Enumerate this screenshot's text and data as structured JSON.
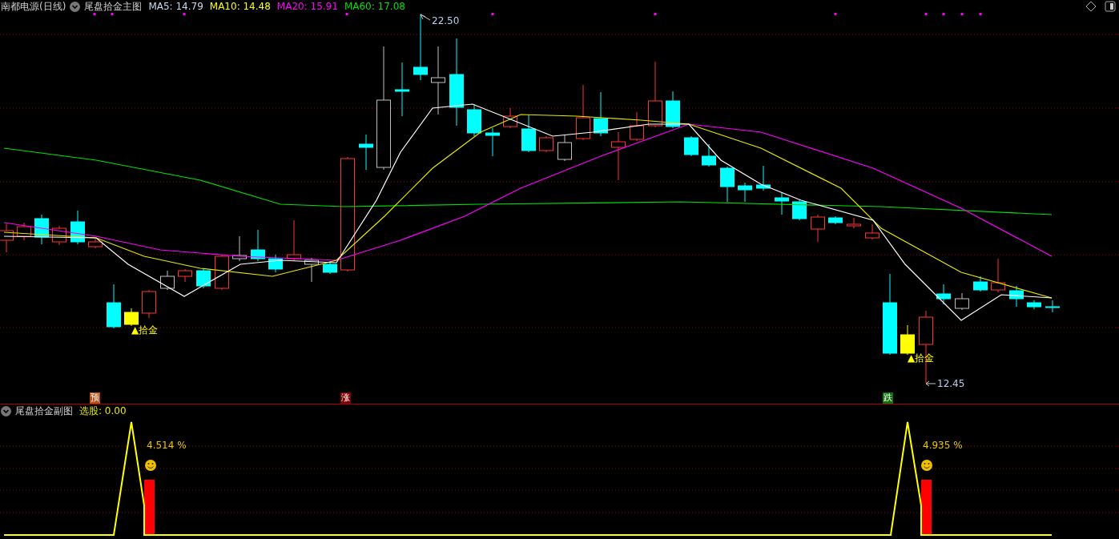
{
  "header": {
    "stock": "南都电源(日线)",
    "indicator": "尾盘拾金主图",
    "legend": [
      {
        "label": "MA5: 14.79",
        "color": "#c8dcf0"
      },
      {
        "label": "MA10: 14.48",
        "color": "#ffff00"
      },
      {
        "label": "MA20: 15.91",
        "color": "#ff00ff"
      },
      {
        "label": "MA60: 17.08",
        "color": "#00e000"
      }
    ]
  },
  "annotations": {
    "high": "22.50",
    "low": "12.45"
  },
  "signals": [
    {
      "label": "▲拾金"
    },
    {
      "label": "▲拾金"
    }
  ],
  "markers": [
    {
      "label": "预",
      "color": "#c0501a"
    },
    {
      "label": "涨",
      "color": "#800000"
    },
    {
      "label": "跌",
      "color": "#107010"
    }
  ],
  "sub": {
    "indicator": "尾盘拾金副图",
    "reading": "选股: 0.00",
    "labels": [
      "4.514 %",
      "4.935 %"
    ]
  }
}
